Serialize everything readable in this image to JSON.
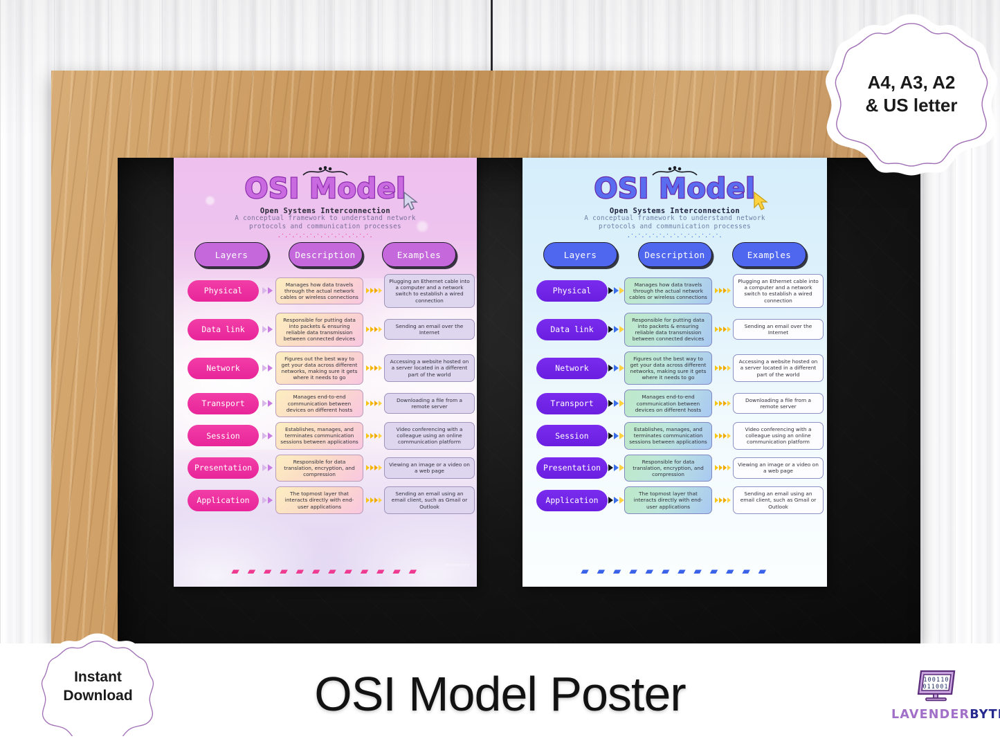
{
  "product": {
    "main_title": "OSI Model Poster",
    "badge_sizes": [
      "A4, A3, A2",
      "& US letter"
    ],
    "badge_instant": [
      "Instant",
      "Download"
    ],
    "brand": {
      "part1": "LAVENDER",
      "part2": "BYTE",
      "binary_top": "100110",
      "binary_bottom": "011001",
      "logo_icon": "monitor-icon"
    }
  },
  "poster": {
    "title": "OSI Model",
    "subtitle": "Open Systems Interconnection",
    "tagline_line1": "A conceptual framework to understand network",
    "tagline_line2": "protocols and communication processes",
    "columns": [
      "Layers",
      "Description",
      "Examples"
    ],
    "rows": [
      {
        "layer": "Physical",
        "description": "Manages how data travels through the actual network cables or wireless connections",
        "example": "Plugging an Ethernet cable into a computer and a network switch to establish a wired connection"
      },
      {
        "layer": "Data link",
        "description": "Responsible for putting data into packets & ensuring reliable data transmission between connected devices",
        "example": "Sending an email over the Internet"
      },
      {
        "layer": "Network",
        "description": "Figures out the best way to get your data across different networks, making sure it gets where it needs to go",
        "example": "Accessing a website hosted on a server located in a different part of the world"
      },
      {
        "layer": "Transport",
        "description": "Manages end-to-end communication between devices on different hosts",
        "example": "Downloading a file from a remote server"
      },
      {
        "layer": "Session",
        "description": "Establishes, manages, and terminates communication sessions between applications",
        "example": "Video conferencing with a colleague using an online communication platform"
      },
      {
        "layer": "Presentation",
        "description": "Responsible for data translation, encryption, and compression",
        "example": "Viewing an image or a video on a web page"
      },
      {
        "layer": "Application",
        "description": "The topmost layer that interacts directly with end-user applications",
        "example": "Sending an email using an email client, such as Gmail or Outlook"
      }
    ],
    "zigzag": "·˙·˙·˙·˙·˙·˙·˙·˙·˙·˙·˙·˙·˙·",
    "footer_deco": "▰ ▰ ▰ ▰ ▰ ▰ ▰ ▰ ▰ ▰ ▰ ▰",
    "watermark": "lavenderbyte"
  },
  "variants": {
    "pink": {
      "name": "pink-variant",
      "layer_color": "#f23da6",
      "header_pill_color": "#c568dc",
      "title_color": "#c96ae0",
      "cursor_color": "#c9c9e8"
    },
    "blue": {
      "name": "blue-variant",
      "layer_color": "#7a2bee",
      "header_pill_color": "#4f67ef",
      "title_color": "#5a6df0",
      "cursor_color": "#ffd23f"
    }
  },
  "scene": {
    "frame": "wooden-frame",
    "board": "chalkboard",
    "wall": "white-plank-wall",
    "wire": "hanging-wire"
  }
}
